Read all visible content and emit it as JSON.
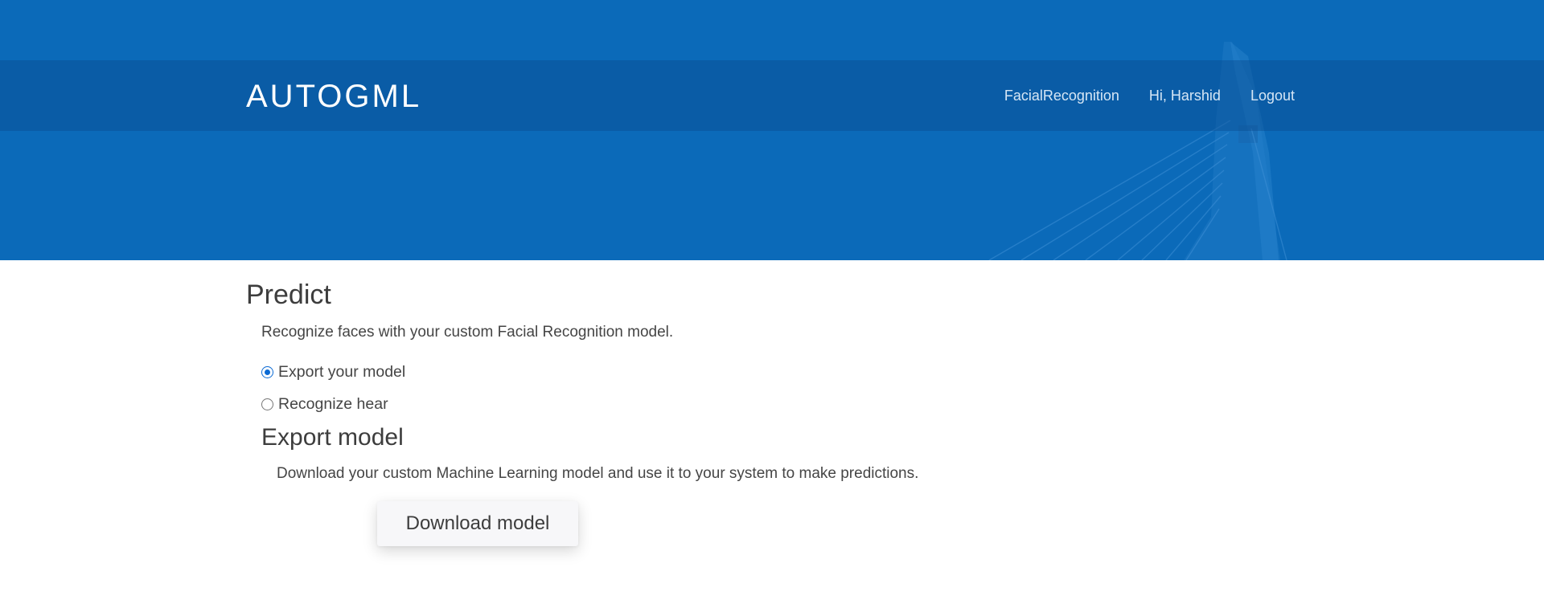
{
  "header": {
    "brand": "AUTOGML",
    "nav": [
      {
        "label": "FacialRecognition"
      },
      {
        "label": "Hi, Harshid"
      },
      {
        "label": "Logout"
      }
    ]
  },
  "main": {
    "title": "Predict",
    "intro": "Recognize faces with your custom Facial Recognition model.",
    "options": [
      {
        "label": "Export your model",
        "checked": true
      },
      {
        "label": "Recognize hear",
        "checked": false
      }
    ],
    "export_section": {
      "title": "Export model",
      "description": "Download your custom Machine Learning model and use it to your system to make predictions.",
      "button_label": "Download model"
    }
  },
  "colors": {
    "hero_background": "#0b6ab9",
    "nav_band": "#0a5aa3",
    "radio_accent": "#0b6ad4",
    "text": "#444444"
  }
}
